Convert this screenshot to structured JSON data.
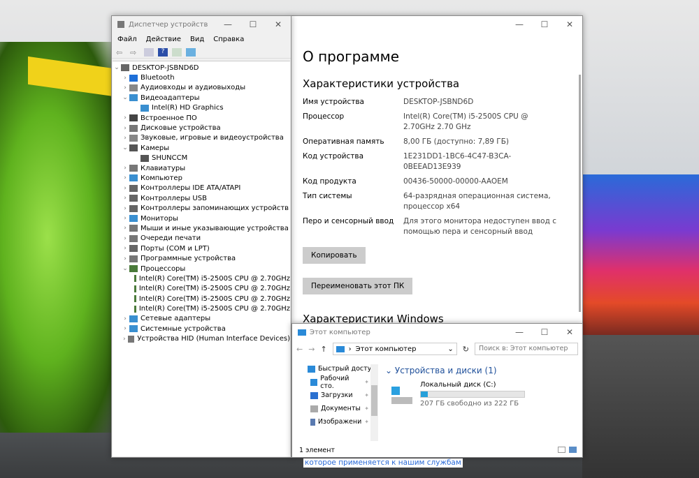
{
  "device_manager": {
    "title": "Диспетчер устройств",
    "menu": [
      "Файл",
      "Действие",
      "Вид",
      "Справка"
    ],
    "root": "DESKTOP-JSBND6D",
    "items": [
      {
        "label": "Bluetooth",
        "level": 1,
        "expanded": false,
        "color": "#1e6fd8"
      },
      {
        "label": "Аудиовходы и аудиовыходы",
        "level": 1,
        "expanded": false,
        "color": "#888"
      },
      {
        "label": "Видеоадаптеры",
        "level": 1,
        "expanded": true,
        "color": "#3a8fd0"
      },
      {
        "label": "Intel(R) HD Graphics",
        "level": 2,
        "color": "#3a8fd0"
      },
      {
        "label": "Встроенное ПО",
        "level": 1,
        "expanded": false,
        "color": "#444"
      },
      {
        "label": "Дисковые устройства",
        "level": 1,
        "expanded": false,
        "color": "#777"
      },
      {
        "label": "Звуковые, игровые и видеоустройства",
        "level": 1,
        "expanded": false,
        "color": "#888"
      },
      {
        "label": "Камеры",
        "level": 1,
        "expanded": true,
        "color": "#555"
      },
      {
        "label": "SHUNCCM",
        "level": 2,
        "color": "#555"
      },
      {
        "label": "Клавиатуры",
        "level": 1,
        "expanded": false,
        "color": "#777"
      },
      {
        "label": "Компьютер",
        "level": 1,
        "expanded": false,
        "color": "#3a8fd0"
      },
      {
        "label": "Контроллеры IDE ATA/ATAPI",
        "level": 1,
        "expanded": false,
        "color": "#666"
      },
      {
        "label": "Контроллеры USB",
        "level": 1,
        "expanded": false,
        "color": "#666"
      },
      {
        "label": "Контроллеры запоминающих устройств",
        "level": 1,
        "expanded": false,
        "color": "#666"
      },
      {
        "label": "Мониторы",
        "level": 1,
        "expanded": false,
        "color": "#3a8fd0"
      },
      {
        "label": "Мыши и иные указывающие устройства",
        "level": 1,
        "expanded": false,
        "color": "#777"
      },
      {
        "label": "Очереди печати",
        "level": 1,
        "expanded": false,
        "color": "#777"
      },
      {
        "label": "Порты (COM и LPT)",
        "level": 1,
        "expanded": false,
        "color": "#666"
      },
      {
        "label": "Программные устройства",
        "level": 1,
        "expanded": false,
        "color": "#777"
      },
      {
        "label": "Процессоры",
        "level": 1,
        "expanded": true,
        "color": "#4a7a3a"
      },
      {
        "label": "Intel(R) Core(TM) i5-2500S CPU @ 2.70GHz",
        "level": 2,
        "color": "#4a7a3a"
      },
      {
        "label": "Intel(R) Core(TM) i5-2500S CPU @ 2.70GHz",
        "level": 2,
        "color": "#4a7a3a"
      },
      {
        "label": "Intel(R) Core(TM) i5-2500S CPU @ 2.70GHz",
        "level": 2,
        "color": "#4a7a3a"
      },
      {
        "label": "Intel(R) Core(TM) i5-2500S CPU @ 2.70GHz",
        "level": 2,
        "color": "#4a7a3a"
      },
      {
        "label": "Сетевые адаптеры",
        "level": 1,
        "expanded": false,
        "color": "#3a8fd0"
      },
      {
        "label": "Системные устройства",
        "level": 1,
        "expanded": false,
        "color": "#3a8fd0"
      },
      {
        "label": "Устройства HID (Human Interface Devices)",
        "level": 1,
        "expanded": false,
        "color": "#777"
      }
    ]
  },
  "about": {
    "title": "О программе",
    "device_section": "Характеристики устройства",
    "specs": [
      {
        "k": "Имя устройства",
        "v": "DESKTOP-JSBND6D"
      },
      {
        "k": "Процессор",
        "v": "Intel(R) Core(TM) i5-2500S CPU @ 2.70GHz 2.70 GHz"
      },
      {
        "k": "Оперативная память",
        "v": "8,00 ГБ (доступно: 7,89 ГБ)"
      },
      {
        "k": "Код устройства",
        "v": "1E231DD1-1BC6-4C47-B3CA-0BEEAD13E939"
      },
      {
        "k": "Код продукта",
        "v": "00436-50000-00000-AAOEM"
      },
      {
        "k": "Тип системы",
        "v": "64-разрядная операционная система, процессор x64"
      },
      {
        "k": "Перо и сенсорный ввод",
        "v": "Для этого монитора недоступен ввод с помощью пера и сенсорный ввод"
      }
    ],
    "copy_button": "Копировать",
    "rename_button": "Переименовать этот ПК",
    "windows_section": "Характеристики Windows",
    "footer_text": "которое применяется к нашим службам"
  },
  "explorer": {
    "title": "Этот компьютер",
    "address": "Этот компьютер",
    "search_placeholder": "Поиск в: Этот компьютер",
    "nav": [
      "Быстрый доступ",
      "Рабочий сто.",
      "Загрузки",
      "Документы",
      "Изображени"
    ],
    "group": "Устройства и диски (1)",
    "drive": {
      "name": "Локальный диск (C:)",
      "free": "207 ГБ свободно из 222 ГБ",
      "used_fraction": 0.068
    },
    "status": "1 элемент"
  }
}
